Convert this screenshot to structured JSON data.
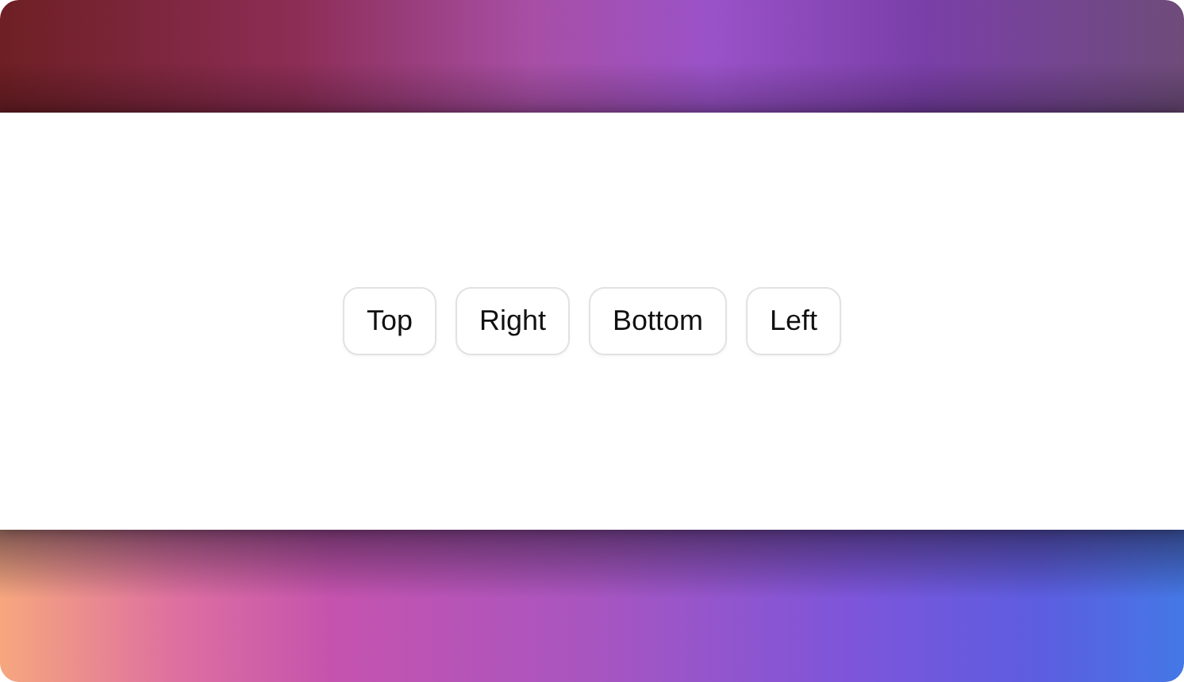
{
  "buttons": [
    "Top",
    "Right",
    "Bottom",
    "Left"
  ]
}
